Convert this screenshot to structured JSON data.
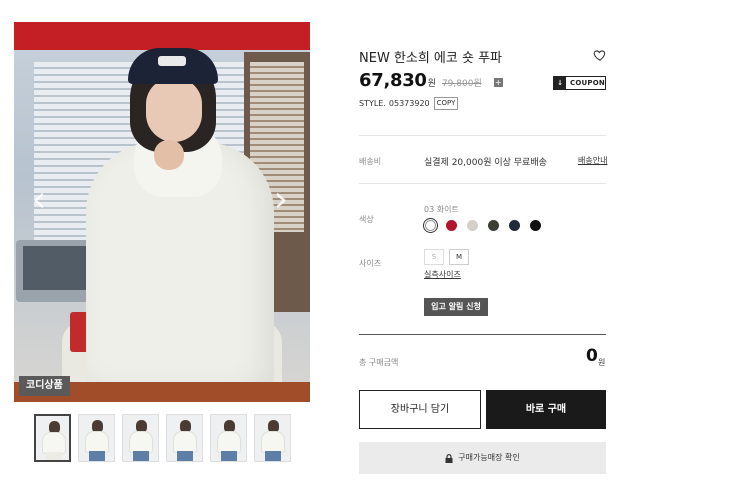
{
  "gallery": {
    "badge": "코디상품",
    "prev_arrow": "‹",
    "next_arrow": "›",
    "thumbnail_count": 6
  },
  "product": {
    "name": "NEW 한소희 에코 숏 푸파",
    "price": "67,830",
    "price_unit": "원",
    "original_price": "79,800원",
    "plus_icon": "plus-icon",
    "coupon_label": "COUPON",
    "style_label": "STYLE.",
    "style_code": "05373920",
    "copy_label": "COPY"
  },
  "shipping": {
    "label": "배송비",
    "text": "실결제 20,000원 이상 무료배송",
    "link": "배송안내"
  },
  "options": {
    "color_label": "색상",
    "selected_color": "03 화이트",
    "colors": [
      "#ffffff",
      "#b0152b",
      "#d4cfc7",
      "#3b3f33",
      "#1f2a3a",
      "#111111"
    ],
    "size_label": "사이즈",
    "sizes": [
      "S",
      "M"
    ],
    "size_guide": "실측사이즈",
    "restock_button": "입고 알림 신청"
  },
  "summary": {
    "total_label": "총 구매금액",
    "total_value": "0",
    "total_unit": "원"
  },
  "actions": {
    "cart_button": "장바구니 담기",
    "buy_button": "바로 구매",
    "store_button": "구매가능매장 확인"
  },
  "colors": {
    "primary_dark": "#1a1a1a",
    "store_button_bg": "#ebebeb"
  }
}
